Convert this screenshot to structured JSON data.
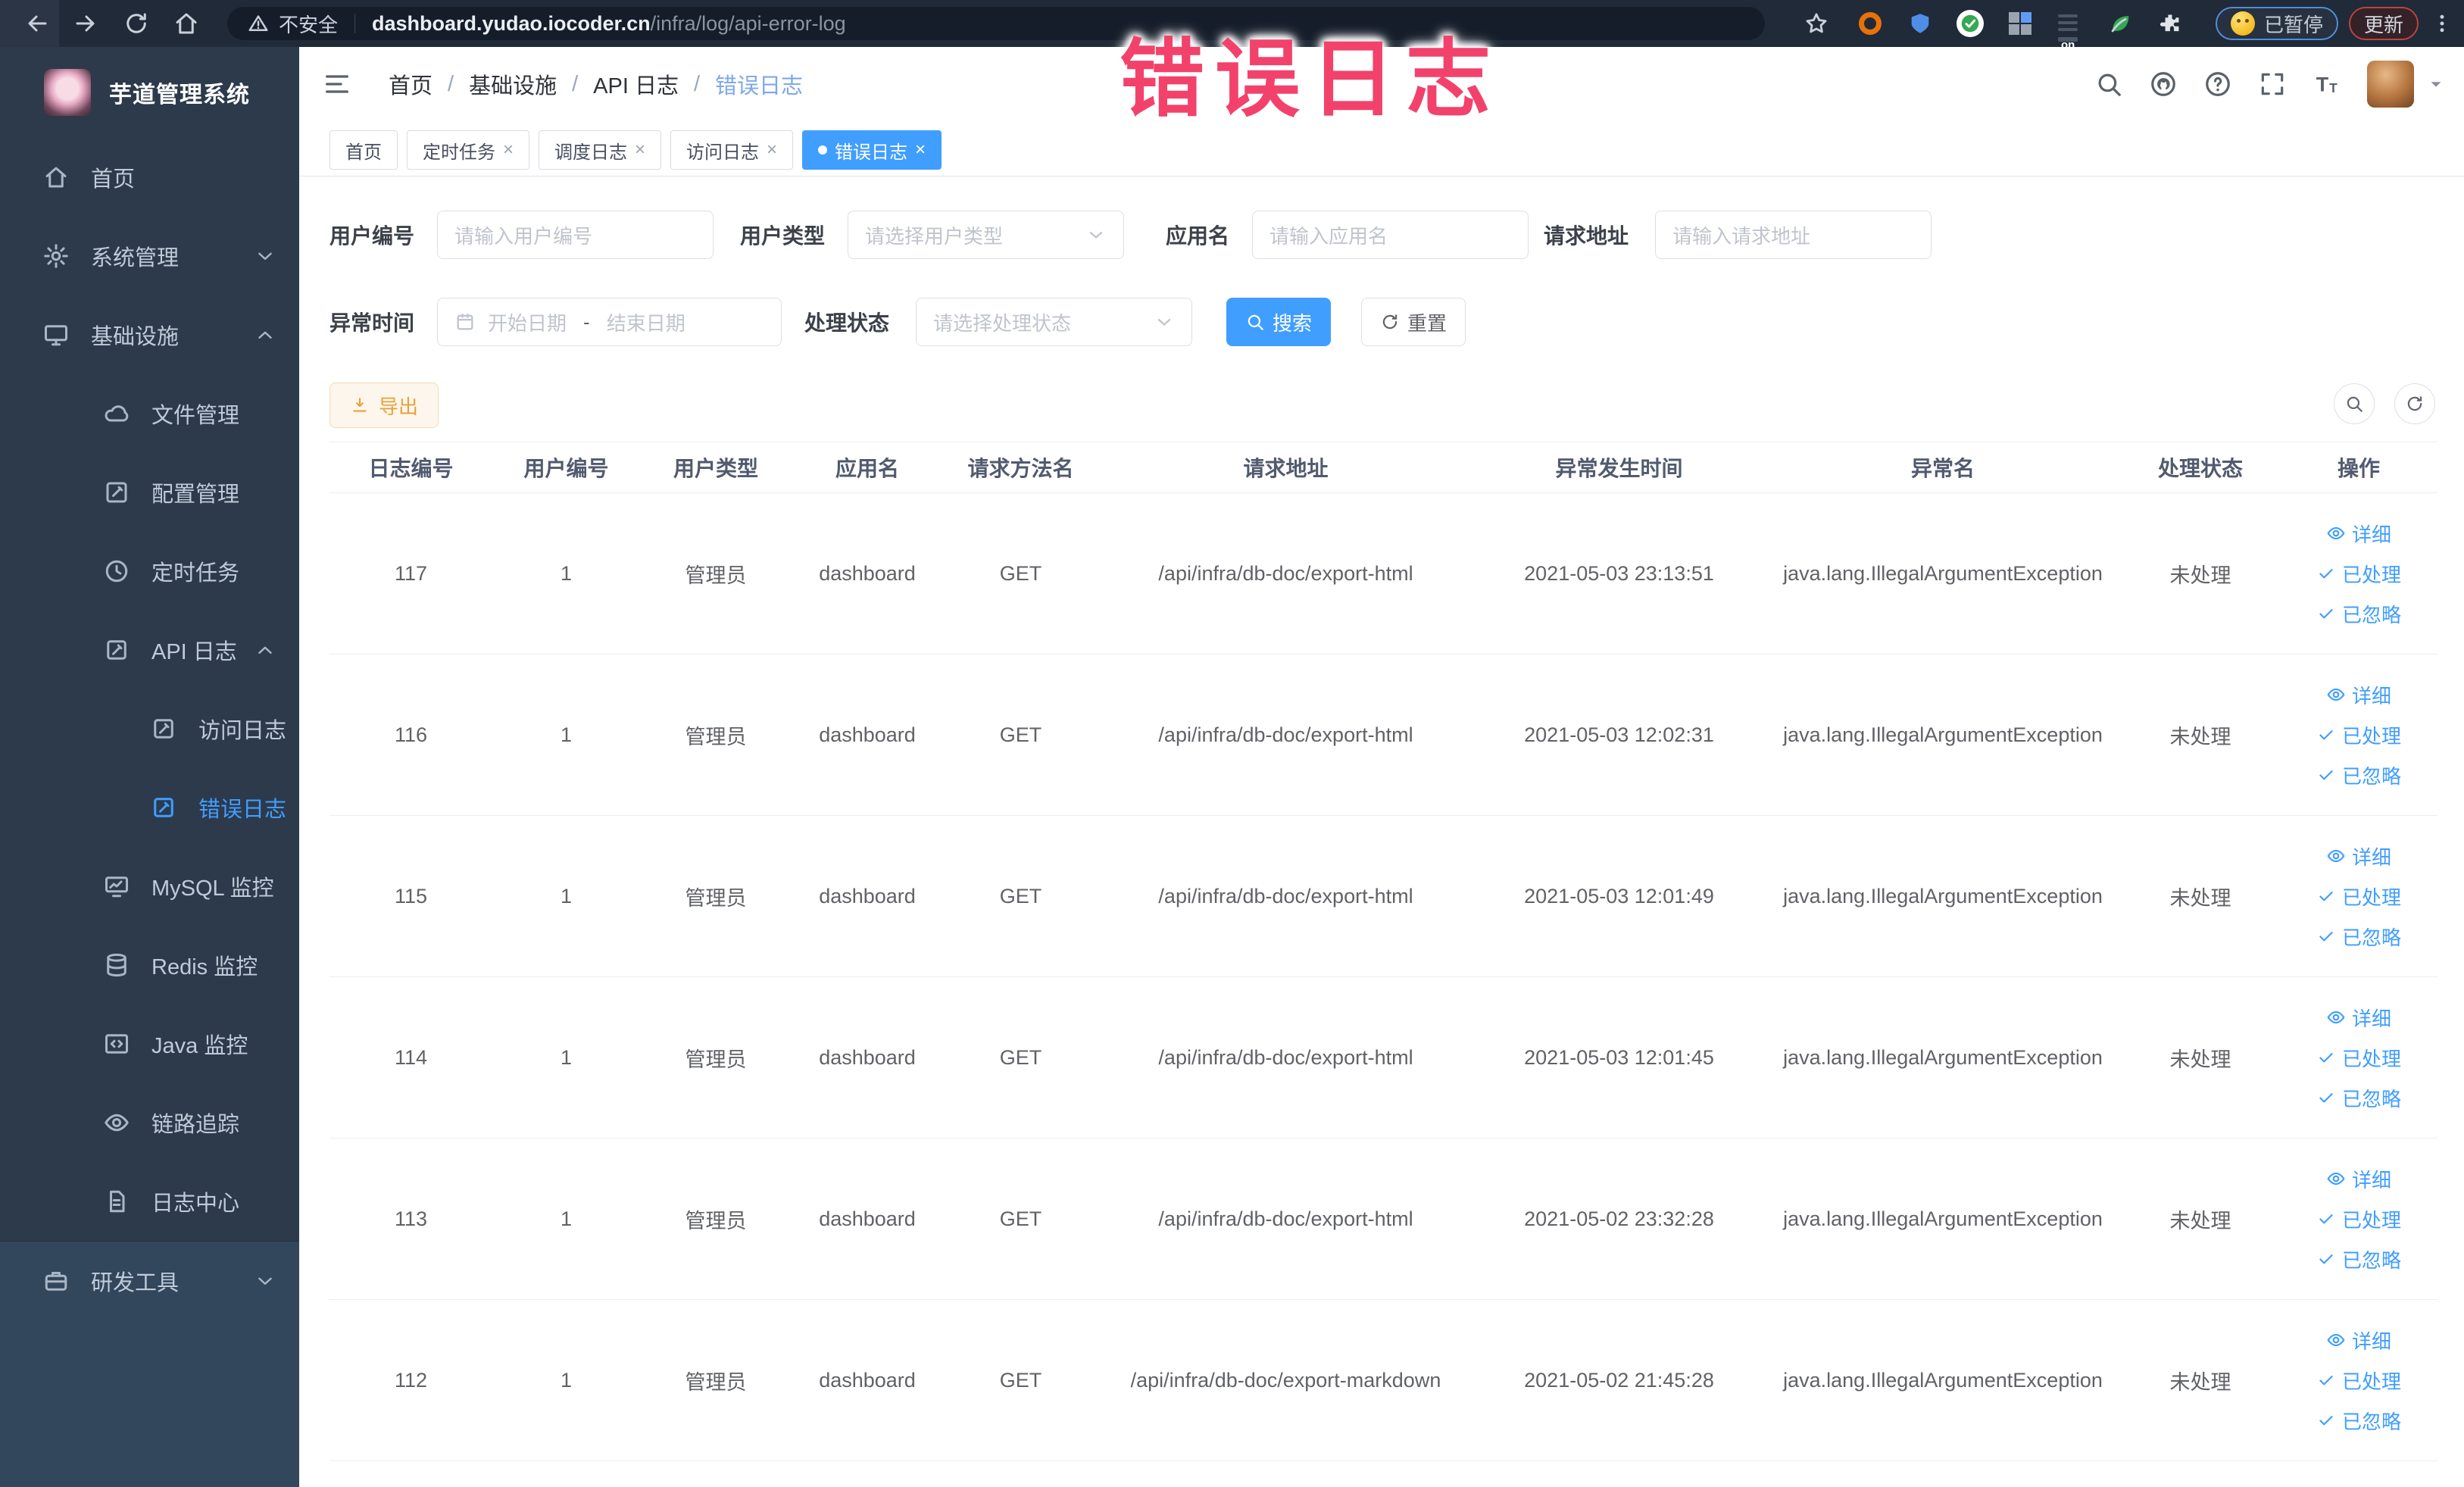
{
  "colors": {
    "primary": "#409eff",
    "warning": "#e6a23c",
    "watermark_red": "#f2426b",
    "sidebar_bg": "#2d3a4b",
    "browser_bg": "#202a38",
    "active_tab": "#409eff"
  },
  "watermark": "错误日志",
  "browser": {
    "nav_icons": [
      "back",
      "forward",
      "reload",
      "home"
    ],
    "security_icon": "warning",
    "security_label": "不安全",
    "url_domain": "dashboard.yudao.iocoder.cn",
    "url_path": "/infra/log/api-error-log",
    "bookmark_icon": "star",
    "extensions": [
      "ext-orange-ring",
      "ext-blue-shield",
      "ext-green-check",
      "ext-grid",
      "ext-on-badge",
      "ext-leaf",
      "ext-puzzle"
    ],
    "paused_badge": {
      "icon": "smiley",
      "label": "已暂停"
    },
    "update_badge": {
      "label": "更新"
    },
    "menu_icon": "kebab-dots"
  },
  "sidebar": {
    "logo_title": "芋道管理系统",
    "menu": [
      {
        "key": "home",
        "label": "首页",
        "icon": "home",
        "level": 1
      },
      {
        "key": "system",
        "label": "系统管理",
        "icon": "gear",
        "level": 1,
        "arrow": "down"
      },
      {
        "key": "infra",
        "label": "基础设施",
        "icon": "monitor",
        "level": 1,
        "arrow": "up"
      },
      {
        "key": "file",
        "label": "文件管理",
        "icon": "cloud",
        "level": 2
      },
      {
        "key": "config",
        "label": "配置管理",
        "icon": "edit",
        "level": 2
      },
      {
        "key": "job",
        "label": "定时任务",
        "icon": "clock",
        "level": 2
      },
      {
        "key": "api-log",
        "label": "API 日志",
        "icon": "doc-pen",
        "level": 2,
        "arrow": "up"
      },
      {
        "key": "access-log",
        "label": "访问日志",
        "icon": "doc-pen",
        "level": 3
      },
      {
        "key": "error-log",
        "label": "错误日志",
        "icon": "doc-pen",
        "level": 3,
        "active": true
      },
      {
        "key": "mysql",
        "label": "MySQL 监控",
        "icon": "chart",
        "level": 2
      },
      {
        "key": "redis",
        "label": "Redis 监控",
        "icon": "database",
        "level": 2
      },
      {
        "key": "java",
        "label": "Java 监控",
        "icon": "code",
        "level": 2
      },
      {
        "key": "trace",
        "label": "链路追踪",
        "icon": "eye",
        "level": 2
      },
      {
        "key": "log-center",
        "label": "日志中心",
        "icon": "doc",
        "level": 2
      },
      {
        "key": "dev-tool",
        "label": "研发工具",
        "icon": "briefcase",
        "level": 1,
        "arrow": "down",
        "section": true
      }
    ]
  },
  "header": {
    "breadcrumb": [
      "首页",
      "基础设施",
      "API 日志",
      "错误日志"
    ],
    "icons": [
      "search",
      "github",
      "help",
      "fullscreen",
      "font-size"
    ]
  },
  "tabs": [
    {
      "label": "首页",
      "closable": false,
      "active": false
    },
    {
      "label": "定时任务",
      "closable": true,
      "active": false
    },
    {
      "label": "调度日志",
      "closable": true,
      "active": false
    },
    {
      "label": "访问日志",
      "closable": true,
      "active": false
    },
    {
      "label": "错误日志",
      "closable": true,
      "active": true
    }
  ],
  "filters": {
    "row1": [
      {
        "key": "user-id",
        "label": "用户编号",
        "type": "input",
        "placeholder": "请输入用户编号"
      },
      {
        "key": "user-type",
        "label": "用户类型",
        "type": "select",
        "placeholder": "请选择用户类型"
      },
      {
        "key": "app-name",
        "label": "应用名",
        "type": "input",
        "placeholder": "请输入应用名"
      },
      {
        "key": "req-url",
        "label": "请求地址",
        "type": "input",
        "placeholder": "请输入请求地址"
      }
    ],
    "row2": {
      "time_label": "异常时间",
      "start_placeholder": "开始日期",
      "range_separator": "-",
      "end_placeholder": "结束日期",
      "status_label": "处理状态",
      "status_placeholder": "请选择处理状态",
      "search_label": "搜索",
      "reset_label": "重置"
    }
  },
  "toolbar": {
    "export_label": "导出"
  },
  "table": {
    "columns": [
      "日志编号",
      "用户编号",
      "用户类型",
      "应用名",
      "请求方法名",
      "请求地址",
      "异常发生时间",
      "异常名",
      "处理状态",
      "操作"
    ],
    "actions": [
      {
        "label": "详细",
        "icon": "eye"
      },
      {
        "label": "已处理",
        "icon": "check"
      },
      {
        "label": "已忽略",
        "icon": "check"
      }
    ],
    "rows": [
      {
        "id": "117",
        "user_id": "1",
        "user_type": "管理员",
        "app": "dashboard",
        "method": "GET",
        "url": "/api/infra/db-doc/export-html",
        "time": "2021-05-03 23:13:51",
        "exception": "java.lang.IllegalArgumentException",
        "status": "未处理"
      },
      {
        "id": "116",
        "user_id": "1",
        "user_type": "管理员",
        "app": "dashboard",
        "method": "GET",
        "url": "/api/infra/db-doc/export-html",
        "time": "2021-05-03 12:02:31",
        "exception": "java.lang.IllegalArgumentException",
        "status": "未处理"
      },
      {
        "id": "115",
        "user_id": "1",
        "user_type": "管理员",
        "app": "dashboard",
        "method": "GET",
        "url": "/api/infra/db-doc/export-html",
        "time": "2021-05-03 12:01:49",
        "exception": "java.lang.IllegalArgumentException",
        "status": "未处理"
      },
      {
        "id": "114",
        "user_id": "1",
        "user_type": "管理员",
        "app": "dashboard",
        "method": "GET",
        "url": "/api/infra/db-doc/export-html",
        "time": "2021-05-03 12:01:45",
        "exception": "java.lang.IllegalArgumentException",
        "status": "未处理"
      },
      {
        "id": "113",
        "user_id": "1",
        "user_type": "管理员",
        "app": "dashboard",
        "method": "GET",
        "url": "/api/infra/db-doc/export-html",
        "time": "2021-05-02 23:32:28",
        "exception": "java.lang.IllegalArgumentException",
        "status": "未处理"
      },
      {
        "id": "112",
        "user_id": "1",
        "user_type": "管理员",
        "app": "dashboard",
        "method": "GET",
        "url": "/api/infra/db-doc/export-markdown",
        "time": "2021-05-02 21:45:28",
        "exception": "java.lang.IllegalArgumentException",
        "status": "未处理"
      }
    ]
  }
}
